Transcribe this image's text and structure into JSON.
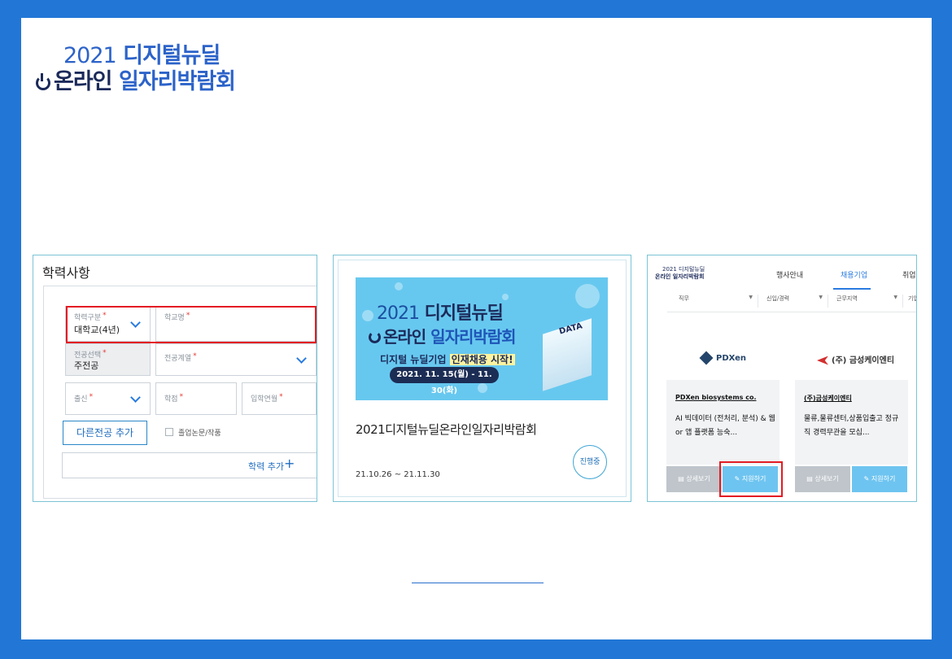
{
  "logo": {
    "year": "2021",
    "line1": "디지털뉴딜",
    "line2_a": "온라인",
    "line2_b": "일자리박람회"
  },
  "education_form": {
    "title": "학력사항",
    "school_type_label": "학력구분",
    "school_type_value": "대학교(4년)",
    "school_name_label": "학교명",
    "major_select_label": "전공선택",
    "major_select_value": "주전공",
    "major_field_label": "전공계열",
    "region_label": "출신",
    "gpa_label": "학점",
    "admission_label": "입학연월",
    "add_major_label": "다른전공 추가",
    "graduation_thesis_label": "졸업논문/작품",
    "add_education_label": "학력 추가",
    "add_education_plus": "+"
  },
  "expo_card": {
    "banner_year": "2021",
    "banner_line1": "디지털뉴딜",
    "banner_line2_a": "온라인",
    "banner_line2_b": "일자리박람회",
    "banner_tagline_a": "디지털 뉴딜기업",
    "banner_tagline_b": "인재채용 시작!",
    "banner_dates": "2021. 11. 15(월) - 11. 30(화)",
    "banner_data_text": "DATA",
    "title": "2021디지털뉴딜온라인일자리박람회",
    "dates": "21.10.26 ~ 21.11.30",
    "status": "진행중"
  },
  "job_listing": {
    "nav_logo_line1": "2021 디지털뉴딜",
    "nav_logo_line2": "온라인 일자리박람회",
    "nav_items": [
      "행사안내",
      "채용기업",
      "취업"
    ],
    "filters": [
      "직무",
      "신입/경력",
      "근무지역",
      "기업테마"
    ],
    "companies": [
      {
        "logo_text": "PDXen",
        "name": "PDXen biosystems co.",
        "desc": "AI 빅데이터 (전처리, 분석) & 웹 or 앱 플랫폼 능숙...",
        "detail_label": "상세보기",
        "apply_label": "지원하기"
      },
      {
        "logo_text": "(주) 금성케이엔티",
        "name": "(주)금성케이엔티",
        "desc": "물류,물류센터,상품입출고 정규직 경력무관을 모십...",
        "detail_label": "상세보기",
        "apply_label": "지원하기"
      }
    ]
  },
  "colors": {
    "frame_blue": "#2277d6",
    "accent_blue": "#2a7be0",
    "highlight_red": "#e31b23",
    "banner_sky": "#67c8ef"
  }
}
